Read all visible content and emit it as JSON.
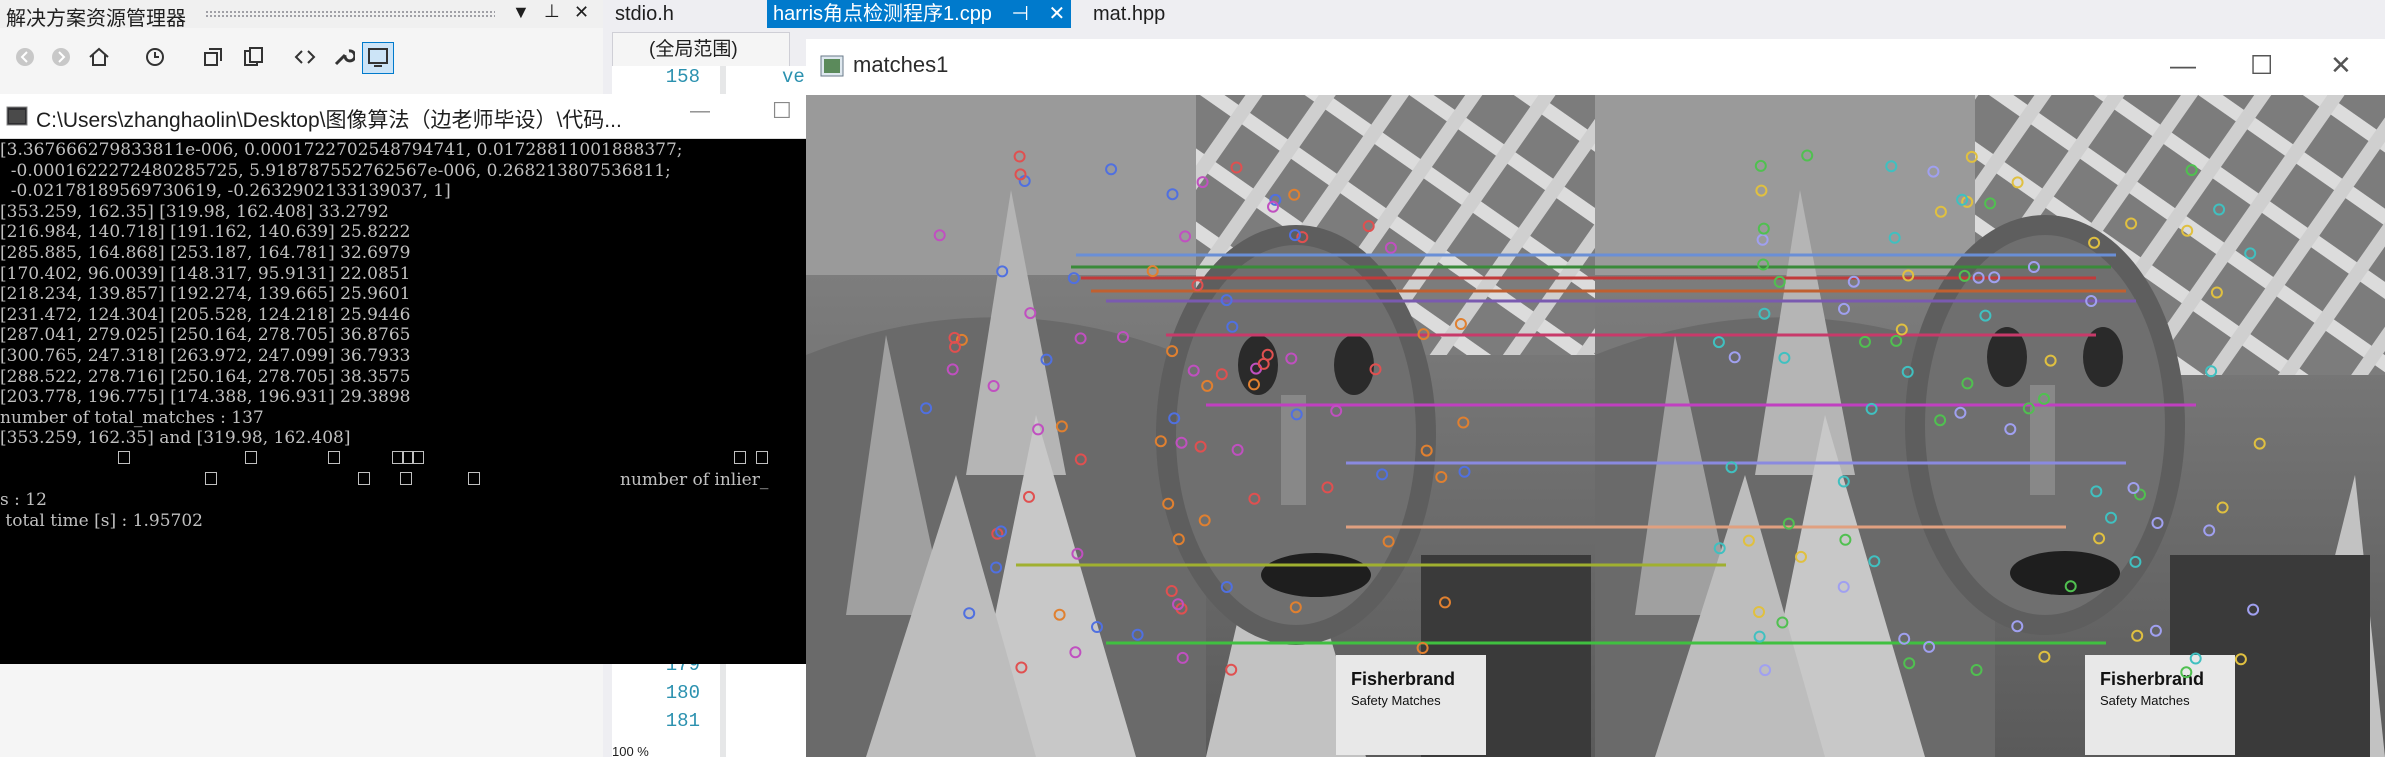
{
  "solution_explorer": {
    "title": "解决方案资源管理器",
    "buttons": {
      "dropdown": "▼",
      "pin": "⊥",
      "close": "✕"
    },
    "toolbar_icons": [
      "back-icon",
      "forward-icon",
      "home-icon",
      "history-icon",
      "collapse-icon",
      "copy-icon",
      "code-icon",
      "wrench-icon",
      "preview-icon"
    ]
  },
  "editor": {
    "tabs": [
      {
        "label": "stdio.h",
        "active": false
      },
      {
        "label": "harris角点检测程序1.cpp",
        "active": true,
        "pin": "⊣",
        "close": "✕"
      },
      {
        "label": "mat.hpp",
        "active": false
      }
    ],
    "scope": "(全局范围)",
    "line_numbers": [
      "158",
      "179",
      "180",
      "181"
    ],
    "code_fragment": "ve",
    "zoom": "100 %"
  },
  "console": {
    "title": "C:\\Users\\zhanghaolin\\Desktop\\图像算法（边老师毕设）\\代码...",
    "min": "—",
    "max": "☐",
    "lines": [
      "[3.367666279833811e-006, 0.0001722702548794741, 0.01728811001888377;",
      "  -0.0001622272480285725, 5.918787552762567e-006, 0.268213807536811;",
      "  -0.02178189569730619, -0.2632902133139037, 1]",
      "[353.259, 162.35] [319.98, 162.408] 33.2792",
      "[216.984, 140.718] [191.162, 140.639] 25.8222",
      "[285.885, 164.868] [253.187, 164.781] 32.6979",
      "[170.402, 96.0039] [148.317, 95.9131] 22.0851",
      "[218.234, 139.857] [192.274, 139.665] 25.9601",
      "[231.472, 124.304] [205.528, 124.218] 25.9446",
      "[287.041, 279.025] [250.164, 278.705] 36.8765",
      "[300.765, 247.318] [263.972, 247.099] 36.7933",
      "[288.522, 278.716] [250.164, 278.705] 38.3575",
      "[203.778, 196.775] [174.388, 196.931] 29.3898",
      "number of total_matches : 137",
      "[353.259, 162.35] and [319.98, 162.408]"
    ],
    "inlier_label": "number of inlier_",
    "lines_after": [
      "s : 12",
      " total time [s] : 1.95702"
    ]
  },
  "matches_window": {
    "title": "matches1",
    "min": "—",
    "max": "☐",
    "close": "✕",
    "brand_left": "Fisherbrand",
    "brand_left_sub": "Safety Matches",
    "brand_right": "Fisherbrand",
    "brand_right_sub": "Safety Matches"
  }
}
